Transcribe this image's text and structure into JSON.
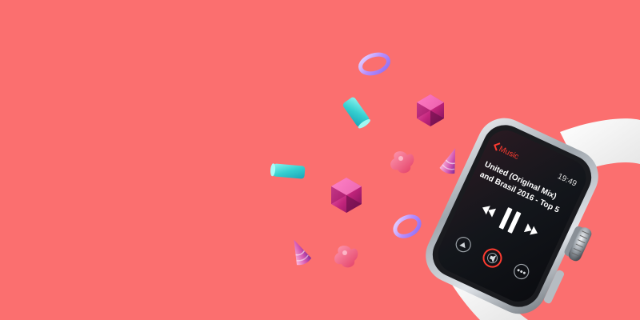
{
  "watch": {
    "app_label": "Music",
    "time": "19:49",
    "track_line1": "United (Original Mix)",
    "track_line2": "and Brasil 2016 - Top 5"
  },
  "colors": {
    "background": "#fb6f6f",
    "accent_red": "#ff3b30",
    "ring": "#c9a7ff",
    "cyan": "#3fd3cf",
    "magenta": "#b51f7a",
    "pink": "#ff6a8e",
    "strap": "#f7f7f7"
  },
  "icons": [
    "back-chevron-icon",
    "rewind-icon",
    "pause-icon",
    "fast-forward-icon",
    "airplay-icon",
    "volume-icon",
    "more-icon"
  ]
}
